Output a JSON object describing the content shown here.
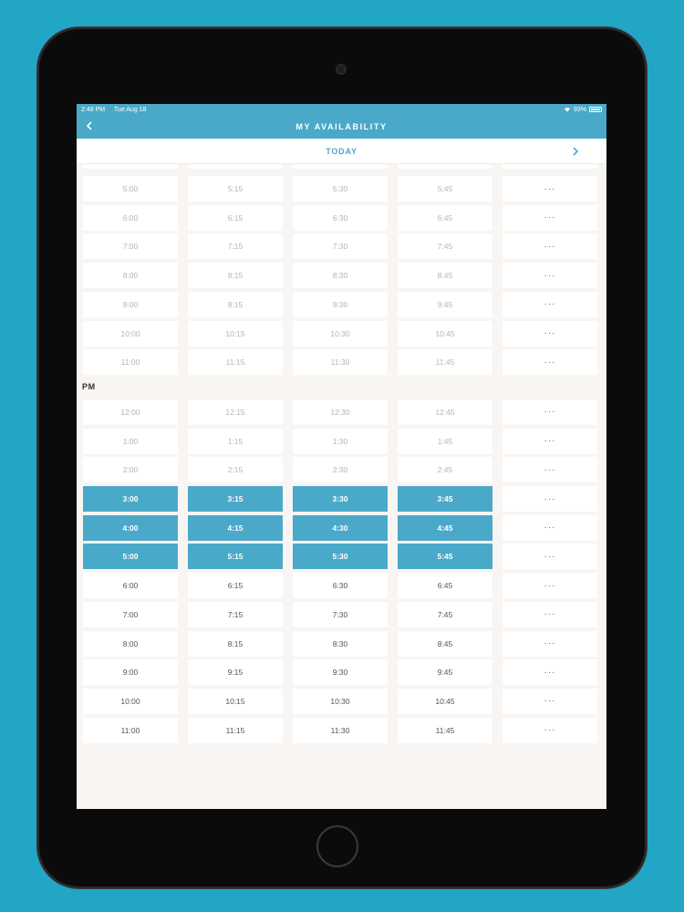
{
  "status_bar": {
    "time": "2:48 PM",
    "date": "Tue Aug 18",
    "battery": "93%"
  },
  "header": {
    "title": "MY AVAILABILITY"
  },
  "date_nav": {
    "label": "TODAY"
  },
  "more_label": "···",
  "am_rows": [
    {
      "slots": [
        "5:00",
        "5:15",
        "5:30",
        "5:45"
      ],
      "selected": false,
      "past": true
    },
    {
      "slots": [
        "6:00",
        "6:15",
        "6:30",
        "6:45"
      ],
      "selected": false,
      "past": true
    },
    {
      "slots": [
        "7:00",
        "7:15",
        "7:30",
        "7:45"
      ],
      "selected": false,
      "past": true
    },
    {
      "slots": [
        "8:00",
        "8:15",
        "8:30",
        "8:45"
      ],
      "selected": false,
      "past": true
    },
    {
      "slots": [
        "9:00",
        "9:15",
        "9:30",
        "9:45"
      ],
      "selected": false,
      "past": true
    },
    {
      "slots": [
        "10:00",
        "10:15",
        "10:30",
        "10:45"
      ],
      "selected": false,
      "past": true
    },
    {
      "slots": [
        "11:00",
        "11:15",
        "11:30",
        "11:45"
      ],
      "selected": false,
      "past": true
    }
  ],
  "pm_section": {
    "label": "PM",
    "rows": [
      {
        "slots": [
          "12:00",
          "12:15",
          "12:30",
          "12:45"
        ],
        "selected": false,
        "past": true
      },
      {
        "slots": [
          "1:00",
          "1:15",
          "1:30",
          "1:45"
        ],
        "selected": false,
        "past": true
      },
      {
        "slots": [
          "2:00",
          "2:15",
          "2:30",
          "2:45"
        ],
        "selected": false,
        "past": true
      },
      {
        "slots": [
          "3:00",
          "3:15",
          "3:30",
          "3:45"
        ],
        "selected": true,
        "past": false
      },
      {
        "slots": [
          "4:00",
          "4:15",
          "4:30",
          "4:45"
        ],
        "selected": true,
        "past": false
      },
      {
        "slots": [
          "5:00",
          "5:15",
          "5:30",
          "5:45"
        ],
        "selected": true,
        "past": false
      },
      {
        "slots": [
          "6:00",
          "6:15",
          "6:30",
          "6:45"
        ],
        "selected": false,
        "past": false
      },
      {
        "slots": [
          "7:00",
          "7:15",
          "7:30",
          "7:45"
        ],
        "selected": false,
        "past": false
      },
      {
        "slots": [
          "8:00",
          "8:15",
          "8:30",
          "8:45"
        ],
        "selected": false,
        "past": false
      },
      {
        "slots": [
          "9:00",
          "9:15",
          "9:30",
          "9:45"
        ],
        "selected": false,
        "past": false
      },
      {
        "slots": [
          "10:00",
          "10:15",
          "10:30",
          "10:45"
        ],
        "selected": false,
        "past": false
      },
      {
        "slots": [
          "11:00",
          "11:15",
          "11:30",
          "11:45"
        ],
        "selected": false,
        "past": false
      }
    ]
  },
  "colors": {
    "accent": "#4aa9c9",
    "background": "#21a6c6",
    "screen_bg": "#f8f5f3"
  }
}
